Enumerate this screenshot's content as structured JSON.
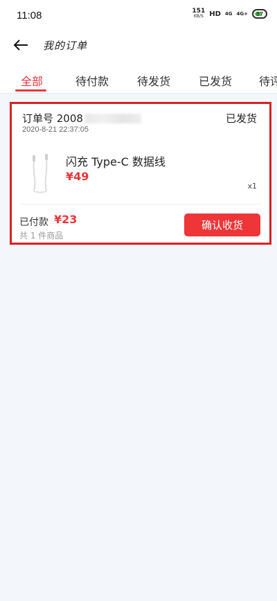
{
  "status_bar": {
    "time": "11:08",
    "speed_value": "151",
    "speed_unit": "KB/S",
    "hd": "HD",
    "signal1": "4G",
    "signal2": "4G+",
    "battery": "87"
  },
  "header": {
    "title": "我的订单"
  },
  "tabs": [
    {
      "label": "全部",
      "active": true
    },
    {
      "label": "待付款"
    },
    {
      "label": "待发货"
    },
    {
      "label": "已发货"
    },
    {
      "label": "待评"
    }
  ],
  "order": {
    "order_no_prefix": "订单号 2008",
    "status": "已发货",
    "time": "2020-8-21 22:37:05",
    "product": {
      "icon": "usb-cable-icon",
      "name": "闪充 Type-C 数据线",
      "price": "¥49",
      "qty": "x1"
    },
    "paid_label": "已付款",
    "paid_amount": "¥23",
    "item_count": "共 1 件商品",
    "confirm_label": "确认收货"
  },
  "colors": {
    "accent": "#e8363a",
    "highlight_border": "#d92020",
    "background": "#f3f6fa"
  }
}
